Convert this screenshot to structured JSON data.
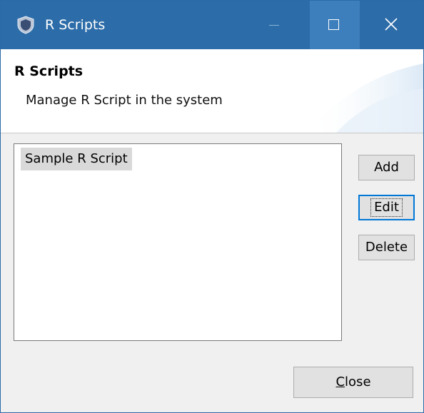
{
  "window": {
    "title": "R Scripts",
    "icons": {
      "app": "shield-app-icon",
      "minimize": "minimize-icon",
      "maximize": "maximize-icon",
      "close": "close-icon"
    }
  },
  "header": {
    "title": "R Scripts",
    "subtitle": "Manage R Script in the system"
  },
  "scripts_list": {
    "items": [
      {
        "label": "Sample R Script",
        "selected": true
      }
    ]
  },
  "actions": {
    "add_label": "Add",
    "edit_label": "Edit",
    "delete_label": "Delete"
  },
  "footer": {
    "close_mnemonic": "C",
    "close_rest": "lose"
  },
  "colors": {
    "titlebar": "#2c6ca8",
    "maximize_hover": "#3d7fbc",
    "selection": "#d9d9d9",
    "focus_border": "#0078d7",
    "dialog_bg": "#f0f0f0"
  }
}
